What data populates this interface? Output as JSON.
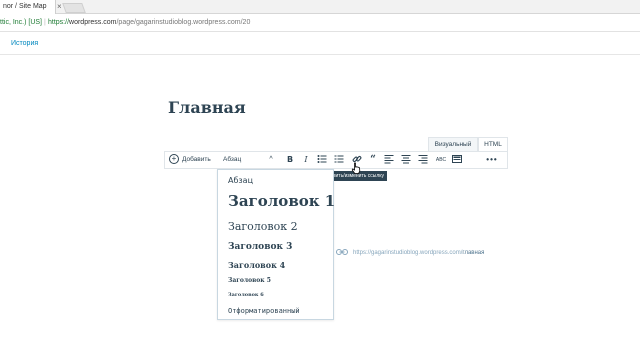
{
  "browser": {
    "tab_title": "nor / Site Map",
    "tab_close": "×",
    "cert": "ttic, Inc.) [US]",
    "url_scheme": "https://",
    "url_host": "wordpress.com",
    "url_path": "/page/gagarinstudioblog.wordpress.com/20"
  },
  "topbar": {
    "history_label": "История"
  },
  "editor": {
    "title": "Главная",
    "permalink_base": "https://gagarinstudioblog.wordpress.com/",
    "permalink_slug": "главная",
    "mode_tabs": [
      "Визуальный",
      "HTML"
    ],
    "toolbar": {
      "add_label": "Добавить",
      "format_label": "Абзац",
      "bold": "B",
      "italic": "I",
      "quote": "“",
      "spell": "ABC",
      "more": "•••"
    },
    "tooltip": "Вставить/изменить ссылку",
    "format_options": [
      "Абзац",
      "Заголовок 1",
      "Заголовок 2",
      "Заголовок 3",
      "Заголовок 4",
      "Заголовок 5",
      "Заголовок 6",
      "Отформатированный"
    ]
  },
  "colors": {
    "text_dark": "#2e4453",
    "link_blue": "#0087be",
    "border": "#e0e5e9"
  }
}
